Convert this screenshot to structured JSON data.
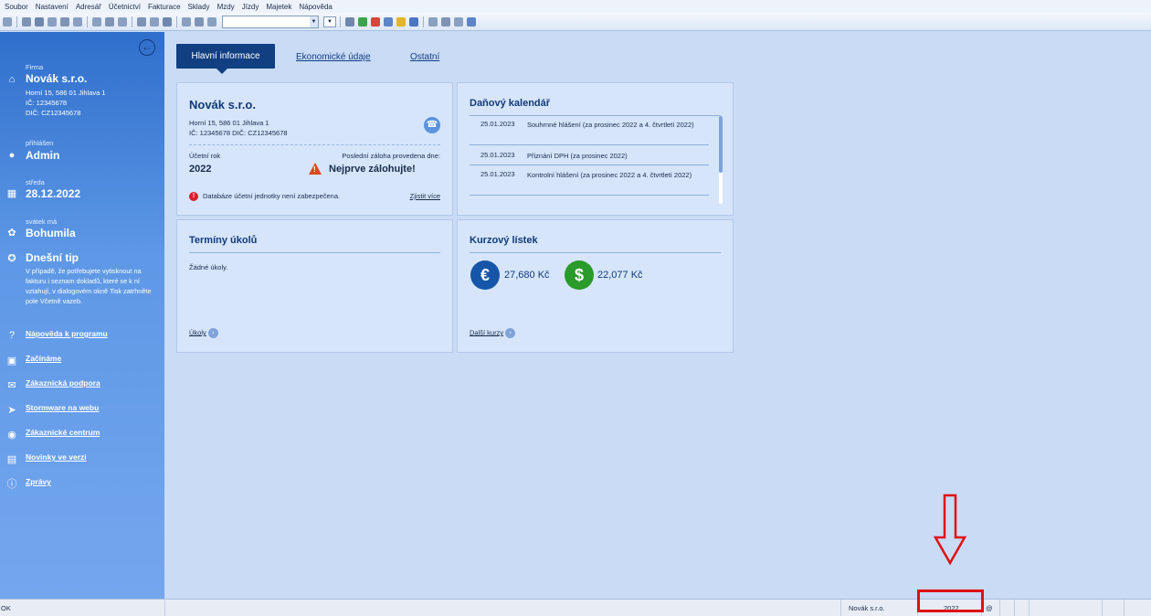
{
  "menubar": [
    "Soubor",
    "Nastavení",
    "Adresář",
    "Účetnictví",
    "Fakturace",
    "Sklady",
    "Mzdy",
    "Jízdy",
    "Majetek",
    "Nápověda"
  ],
  "sidebar": {
    "firm_label": "Firma",
    "firm_name": "Novák s.r.o.",
    "firm_address": "Horní 15, 586 01 Jihlava 1",
    "firm_ic": "IČ: 12345678",
    "firm_dic": "DIČ: CZ12345678",
    "login_label": "přihlášen",
    "login_user": "Admin",
    "day_label": "středa",
    "date": "28.12.2022",
    "nameday_label": "svátek má",
    "nameday": "Bohumila",
    "tip_title": "Dnešní tip",
    "tip_text": "V případě, že potřebujete vytisknout na fakturu i seznam dokladů, které se k ní vztahují, v dialogovém okně Tisk zatrhněte pole Včetně vazeb.",
    "links": [
      "Nápověda k programu",
      "Začínáme",
      "Zákaznická podpora",
      "Stormware na webu",
      "Zákaznické centrum",
      "Novinky ve verzi",
      "Zprávy"
    ]
  },
  "tabs": {
    "active": "Hlavní informace",
    "economic": "Ekonomické údaje",
    "other": "Ostatní"
  },
  "firm_panel": {
    "title": "Novák s.r.o.",
    "address": "Horní 15, 586 01 Jihlava 1",
    "ids": "IČ: 12345678  DIČ: CZ12345678",
    "year_label": "Účetní rok",
    "year": "2022",
    "backup_label": "Poslední záloha provedena dne:",
    "backup_value": "Nejprve zálohujte!",
    "db_warning": "Databáze účetní jednotky není zabezpečena.",
    "db_link": "Zjistit více"
  },
  "tax_calendar": {
    "title": "Daňový kalendář",
    "rows": [
      {
        "date": "25.01.2023",
        "desc": "Souhrnné hlášení (za prosinec 2022 a 4. čtvrtletí 2022)"
      },
      {
        "date": "25.01.2023",
        "desc": "Přiznání DPH (za prosinec 2022)"
      },
      {
        "date": "25.01.2023",
        "desc": "Kontrolní hlášení (za prosinec 2022 a 4. čtvrtletí 2022)"
      }
    ]
  },
  "tasks_panel": {
    "title": "Termíny úkolů",
    "empty": "Žádné úkoly.",
    "link": "Úkoly"
  },
  "rates_panel": {
    "title": "Kurzový lístek",
    "eur": "27,680 Kč",
    "usd": "22,077 Kč",
    "link": "Další kurzy"
  },
  "statusbar": {
    "ok": "OK",
    "company": "Novák s.r.o.",
    "year": "2022",
    "at": "@"
  },
  "colors": {
    "annotation": "#e01010",
    "tab_active": "#123f82",
    "eur_coin": "#1556a8",
    "usd_coin": "#2a9a2a"
  }
}
